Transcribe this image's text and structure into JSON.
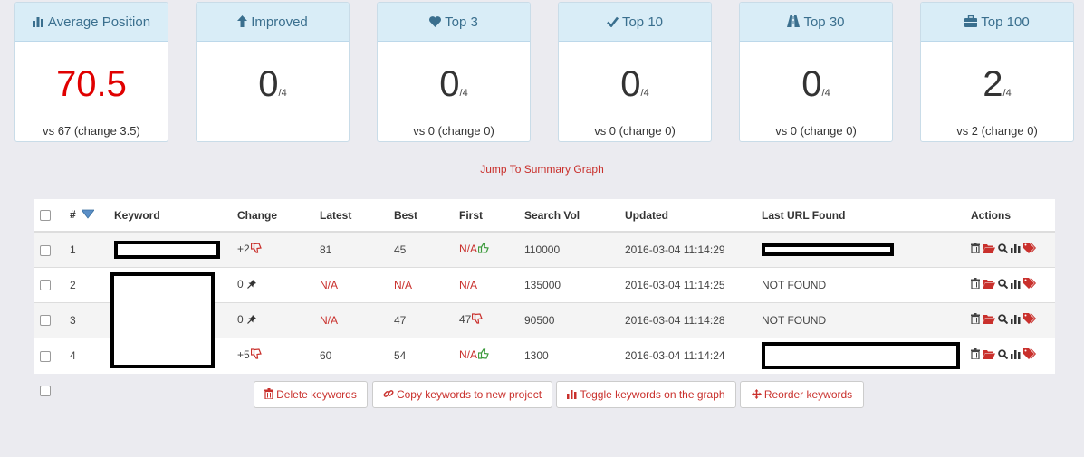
{
  "cards": [
    {
      "title": "Average Position",
      "icon": "bar-chart-icon",
      "value": "70.5",
      "suffix": "",
      "footer": "vs 67 (change 3.5)",
      "value_color": "#e00000"
    },
    {
      "title": "Improved",
      "icon": "arrow-up-icon",
      "value": "0",
      "suffix": "/4",
      "footer": ""
    },
    {
      "title": "Top 3",
      "icon": "heart-icon",
      "value": "0",
      "suffix": "/4",
      "footer": "vs 0 (change 0)"
    },
    {
      "title": "Top 10",
      "icon": "check-icon",
      "value": "0",
      "suffix": "/4",
      "footer": "vs 0 (change 0)"
    },
    {
      "title": "Top 30",
      "icon": "road-icon",
      "value": "0",
      "suffix": "/4",
      "footer": "vs 0 (change 0)"
    },
    {
      "title": "Top 100",
      "icon": "briefcase-icon",
      "value": "2",
      "suffix": "/4",
      "footer": "vs 2 (change 0)"
    }
  ],
  "jump_link": "Jump To Summary Graph",
  "table": {
    "headers": {
      "num": "#",
      "keyword": "Keyword",
      "change": "Change",
      "latest": "Latest",
      "best": "Best",
      "first": "First",
      "search_vol": "Search Vol",
      "updated": "Updated",
      "last_url": "Last URL Found",
      "actions": "Actions"
    },
    "rows": [
      {
        "num": "1",
        "change": "+2",
        "change_icon": "thumbs-down-icon",
        "latest": "81",
        "best": "45",
        "first": "N/A",
        "first_icon": "thumbs-up-icon",
        "search_vol": "110000",
        "updated": "2016-03-04 11:14:29",
        "last_url": ""
      },
      {
        "num": "2",
        "change": "0",
        "change_icon": "pin-icon",
        "latest": "N/A",
        "best": "N/A",
        "first": "N/A",
        "first_icon": "",
        "search_vol": "135000",
        "updated": "2016-03-04 11:14:25",
        "last_url": "NOT FOUND"
      },
      {
        "num": "3",
        "change": "0",
        "change_icon": "pin-icon",
        "latest": "N/A",
        "best": "47",
        "first": "47",
        "first_icon": "thumbs-down-icon",
        "search_vol": "90500",
        "updated": "2016-03-04 11:14:28",
        "last_url": "NOT FOUND"
      },
      {
        "num": "4",
        "change": "+5",
        "change_icon": "thumbs-down-icon",
        "latest": "60",
        "best": "54",
        "first": "N/A",
        "first_icon": "thumbs-up-icon",
        "search_vol": "1300",
        "updated": "2016-03-04 11:14:24",
        "last_url": ""
      }
    ]
  },
  "buttons": {
    "delete": "Delete keywords",
    "copy": "Copy keywords to new project",
    "toggle": "Toggle keywords on the graph",
    "reorder": "Reorder keywords"
  },
  "colors": {
    "accent_red": "#c9302c",
    "header_blue": "#d9edf7",
    "thumb_green": "#3c9a3c"
  }
}
